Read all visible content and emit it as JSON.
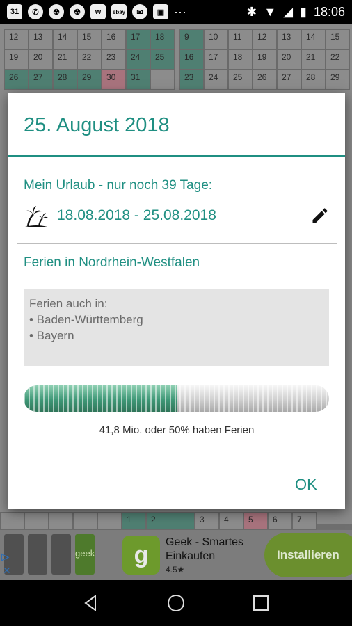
{
  "status_bar": {
    "left_icons": [
      "calendar-icon",
      "whatsapp-icon",
      "radiation-icon",
      "radiation-icon",
      "w-app-icon",
      "ebay-icon",
      "message-icon",
      "image-icon",
      "more-icon"
    ],
    "calendar_badge": "31",
    "ebay_badge": "ebay",
    "time": "18:06"
  },
  "calendar_bg": {
    "left_rows": [
      [
        "12",
        "13",
        "14",
        "15",
        "16",
        "17",
        "18"
      ],
      [
        "19",
        "20",
        "21",
        "22",
        "23",
        "24",
        "25"
      ],
      [
        "26",
        "27",
        "28",
        "29",
        "30",
        "31",
        ""
      ]
    ],
    "right_rows": [
      [
        "9",
        "10",
        "11",
        "12",
        "13",
        "14",
        "15"
      ],
      [
        "16",
        "17",
        "18",
        "19",
        "20",
        "21",
        "22"
      ],
      [
        "23",
        "24",
        "25",
        "26",
        "27",
        "28",
        "29"
      ]
    ],
    "bottom_row": [
      "",
      "",
      "",
      "",
      "",
      "1",
      "2",
      "3",
      "4",
      "5",
      "6",
      "7"
    ]
  },
  "dialog": {
    "title": "25. August 2018",
    "vacation_label": "Mein Urlaub - nur noch 39 Tage:",
    "vacation_dates": "18.08.2018 - 25.08.2018",
    "holiday_label": "Ferien in Nordrhein-Westfalen",
    "also_label": "Ferien auch in:",
    "also_states": [
      "• Baden-Württemberg",
      "• Bayern"
    ],
    "progress_fraction": 0.5,
    "progress_text": "41,8 Mio. oder 50% haben Ferien",
    "ok_label": "OK"
  },
  "ad": {
    "title": "Geek - Smartes Einkaufen",
    "rating": "4.5★",
    "install_label": "Installieren",
    "logo_letter": "g",
    "brand_label": "geek"
  },
  "colors": {
    "accent": "#1f8f82",
    "progress_green": "#3e9776"
  }
}
